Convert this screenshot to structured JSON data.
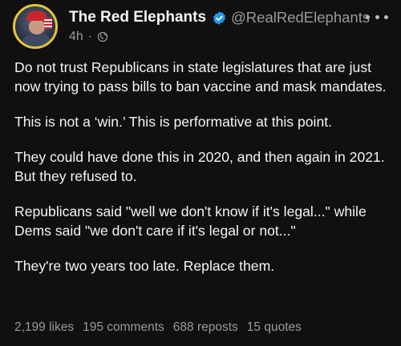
{
  "author": {
    "display_name": "The Red Elephants",
    "handle": "@RealRedElephants",
    "avatar_icon": "avatar-photo",
    "verified_color": "#1d9bf0"
  },
  "meta": {
    "time_ago": "4h",
    "separator": "·",
    "audience_icon": "globe-icon"
  },
  "post": {
    "paragraphs": [
      "Do not trust Republicans in state legislatures that are just now trying to pass bills to ban vaccine and mask mandates.",
      "This is not a ‘win.’ This is performative at this point.",
      "They could have done this in 2020, and then again in 2021. But they refused to.",
      "Republicans said \"well we don't know if it's legal...\" while Dems said \"we don't care if it's legal or not...\"",
      "They're two years too late. Replace them."
    ]
  },
  "stats": {
    "likes": "2,199 likes",
    "comments": "195 comments",
    "reposts": "688 reposts",
    "quotes": "15 quotes"
  },
  "colors": {
    "background": "#101010",
    "text": "#f3f5f7",
    "muted": "#9a9a9a",
    "avatar_ring": "#e7c533"
  }
}
